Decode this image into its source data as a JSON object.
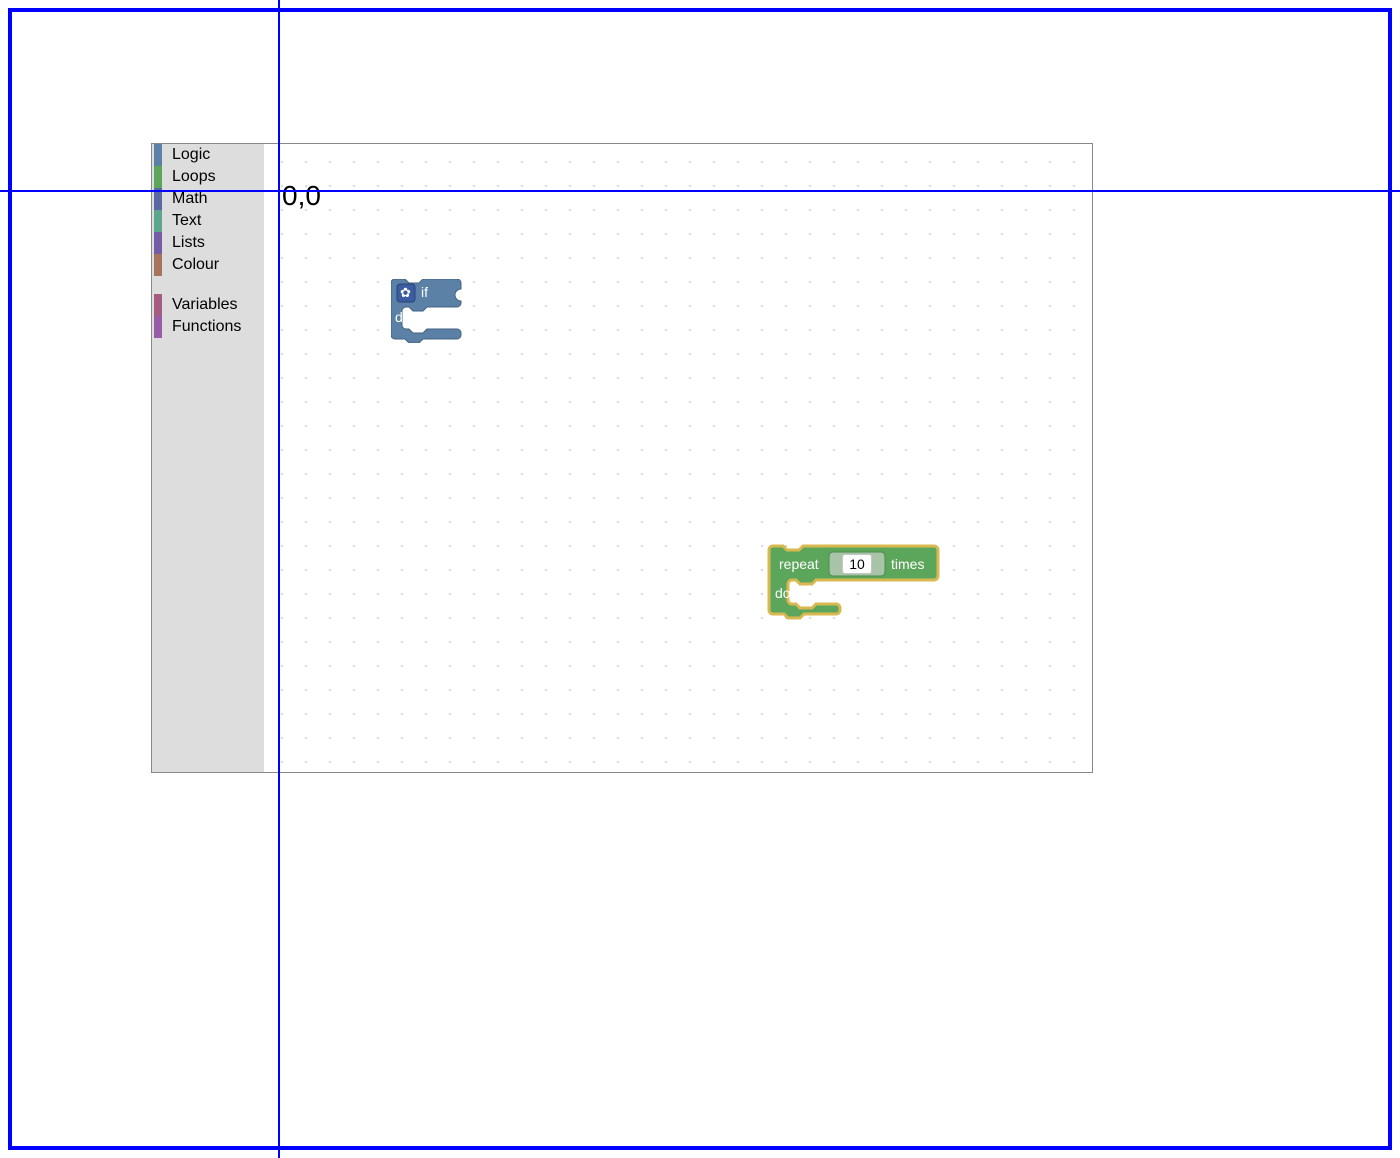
{
  "crosshair": {
    "origin_label": "0,0"
  },
  "toolbox": {
    "items": [
      {
        "label": "Logic",
        "color": "#5C81A6"
      },
      {
        "label": "Loops",
        "color": "#5CA65C"
      },
      {
        "label": "Math",
        "color": "#5C68A6"
      },
      {
        "label": "Text",
        "color": "#5CA68D"
      },
      {
        "label": "Lists",
        "color": "#745CA6"
      },
      {
        "label": "Colour",
        "color": "#A6745C"
      }
    ],
    "items2": [
      {
        "label": "Variables",
        "color": "#A65C81"
      },
      {
        "label": "Functions",
        "color": "#995CA6"
      }
    ]
  },
  "blocks": {
    "if": {
      "if_label": "if",
      "do_label": "do",
      "fill": "#5C81A6",
      "stroke": "#426281"
    },
    "repeat": {
      "repeat_label": "repeat",
      "times_label": "times",
      "do_label": "do",
      "count_value": "10",
      "fill": "#5CA65C",
      "stroke": "#d9b84f",
      "input_bg": "#a8c4a8"
    }
  }
}
